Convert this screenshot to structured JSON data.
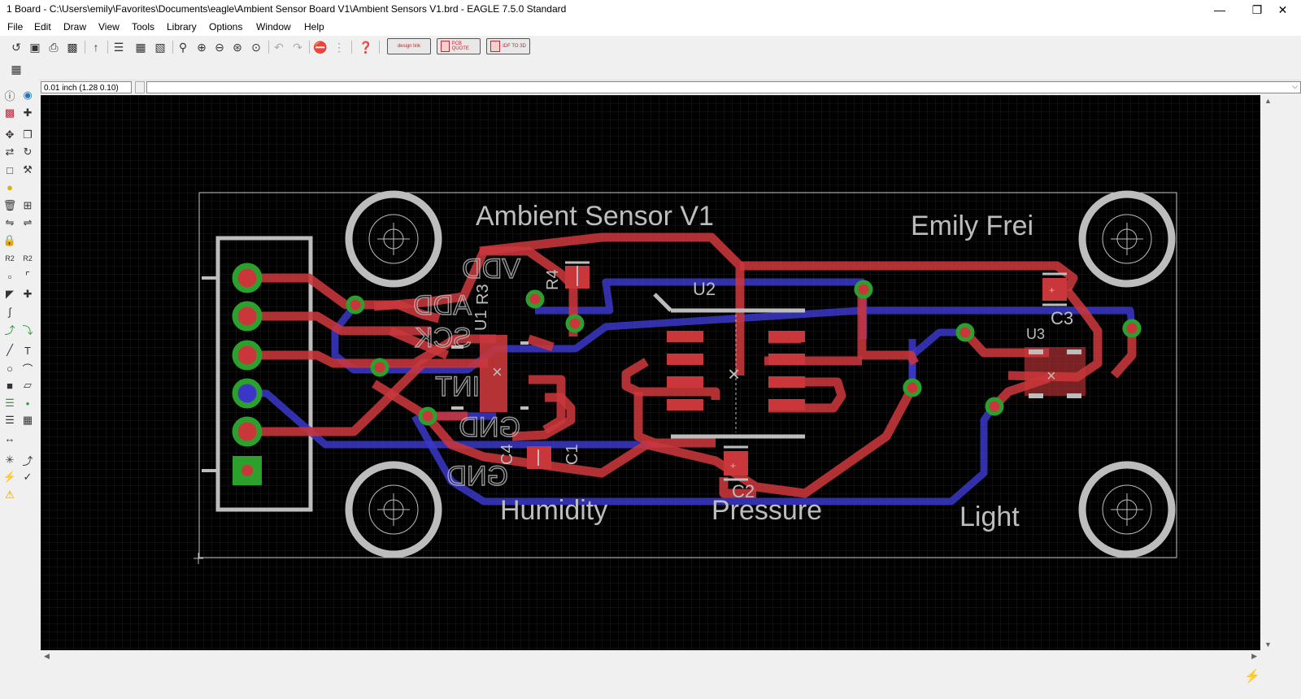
{
  "window": {
    "title": "1 Board - C:\\Users\\emily\\Favorites\\Documents\\eagle\\Ambient Sensor Board V1\\Ambient Sensors V1.brd - EAGLE 7.5.0 Standard",
    "minimize_icon": "minimize-icon",
    "restore_icon": "restore-icon",
    "close_icon": "close-icon"
  },
  "menu": [
    "File",
    "Edit",
    "Draw",
    "View",
    "Tools",
    "Library",
    "Options",
    "Window",
    "Help"
  ],
  "toolbar": {
    "icons": [
      "open-icon",
      "save-icon",
      "print-icon",
      "cam-icon",
      "script-icon",
      "layers-icon",
      "board-icon",
      "package-icon",
      "zoom-fit-icon",
      "zoom-in-icon",
      "zoom-out-icon",
      "zoom-redraw-icon",
      "zoom-select-icon",
      "undo-icon",
      "redo-icon",
      "stop-icon",
      "go-icon",
      "help-icon"
    ],
    "ext_buttons": [
      {
        "label": "design link"
      },
      {
        "label": "PCB QUOTE"
      },
      {
        "label": "IDF TO 3D"
      }
    ],
    "grid_icon": "grid-icon"
  },
  "command": {
    "coordinates": "0.01 inch (1.28 0.10)",
    "value": "",
    "dropdown_icon": "chevron-down-icon"
  },
  "left_tools": [
    "info-icon",
    "show-icon",
    "display-icon",
    "mark-icon",
    "move-icon",
    "copy-icon",
    "mirror-icon",
    "rotate-icon",
    "group-icon",
    "change-icon",
    "paste-icon",
    "delete-icon",
    "add-icon",
    "replace-icon",
    "lock-icon",
    "name-icon",
    "value-icon",
    "smash-icon",
    "split-icon",
    "miter-icon",
    "optimize-icon",
    "route-icon",
    "ripup-icon",
    "wire-icon",
    "text-icon",
    "circle-icon",
    "arc-icon",
    "rect-icon",
    "polygon-icon",
    "via-icon",
    "signal-icon",
    "hole-icon",
    "attribute-icon",
    "dimension-icon",
    "ratsnest-icon",
    "autorouter-icon",
    "drc-icon",
    "errors-icon",
    "erc-icon"
  ],
  "board": {
    "texts": {
      "title": "Ambient Sensor V1",
      "author": "Emily Frei",
      "u2": "U2",
      "u3": "U3",
      "c3": "C3",
      "c2": "C2",
      "r4": "R4",
      "r3": "R3",
      "u1": "U1",
      "c4": "C4",
      "c1": "C1",
      "vdd": "VDD",
      "gnd1": "GND",
      "gnd2": "GND",
      "add": "ADD",
      "sck": "SCK",
      "int": "INT",
      "humidity": "Humidity",
      "pressure": "Pressure",
      "light": "Light"
    },
    "colors": {
      "background": "#000000",
      "grid": "#1c1c1c",
      "top_copper": "#c9373b",
      "bottom_copper": "#3a37c8",
      "via_ring": "#2ca02c",
      "silkscreen": "#bebebe",
      "outline": "#c8c8c8"
    }
  },
  "status": {
    "icon": "lightning-icon"
  }
}
